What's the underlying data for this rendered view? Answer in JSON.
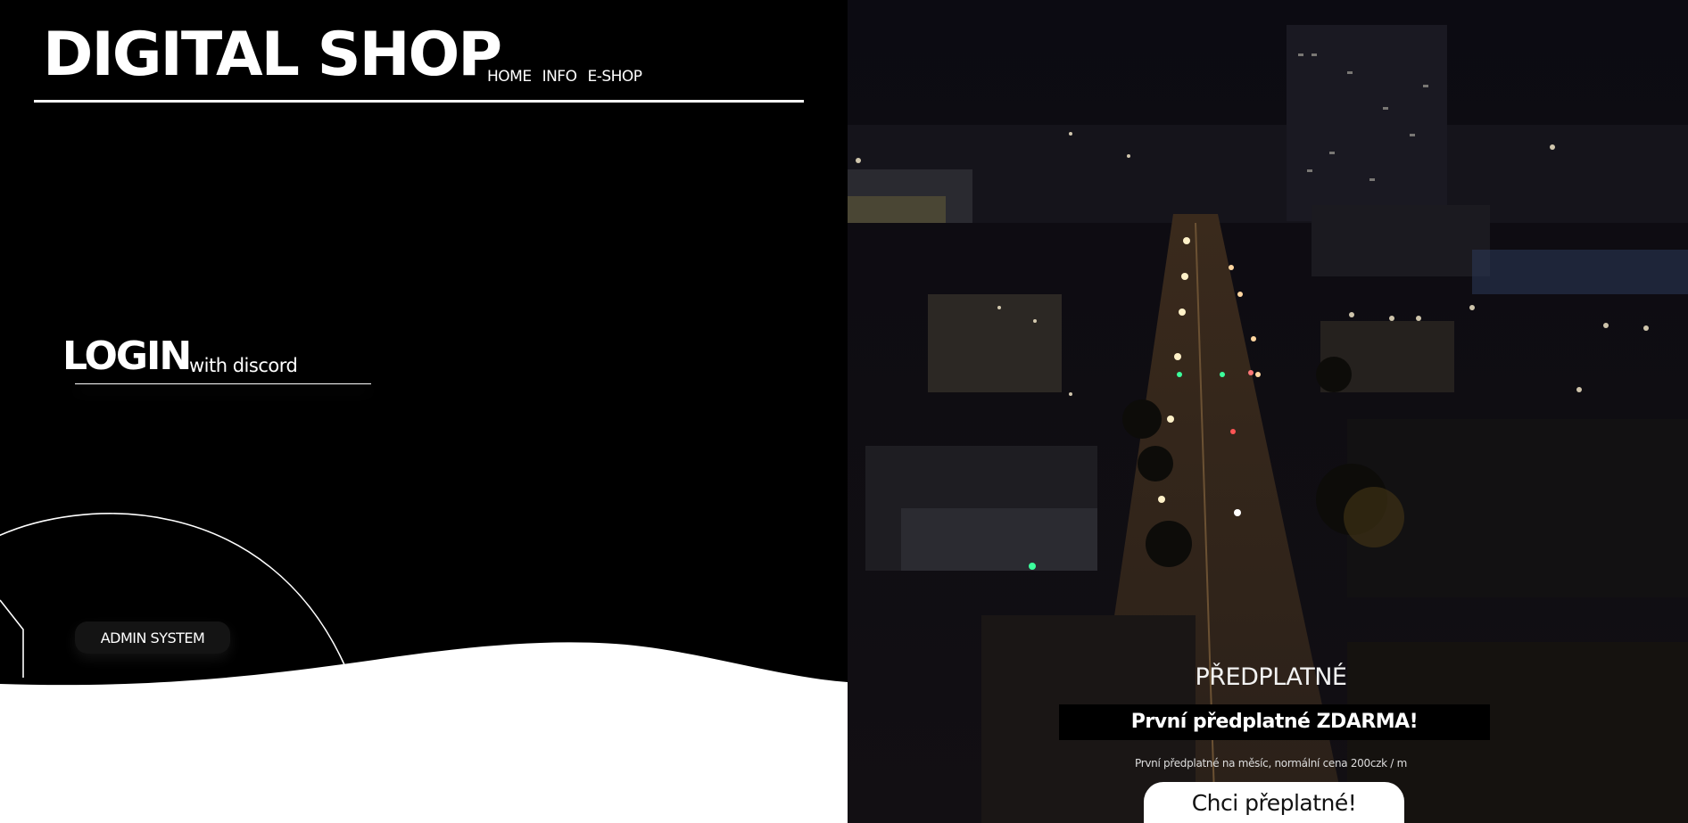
{
  "header": {
    "brand": "DIGITAL SHOP",
    "nav": [
      {
        "label": "HOME"
      },
      {
        "label": "INFO"
      },
      {
        "label": "E-SHOP"
      }
    ]
  },
  "login": {
    "title": "LOGIN",
    "subtitle": "with discord"
  },
  "admin": {
    "button_label": "ADMIN SYSTEM"
  },
  "subscription": {
    "title": "PŘEDPLATNÉ",
    "promo": "První předplatné ZDARMA!",
    "description": "První předplatné na měsíc, normální cena 200czk / m",
    "cta_label": "Chci přeplatné!"
  },
  "colors": {
    "background": "#000000",
    "foreground": "#ffffff",
    "button_dark": "#141414"
  }
}
